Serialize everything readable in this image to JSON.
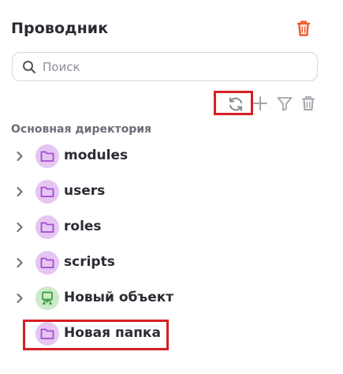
{
  "header": {
    "title": "Проводник",
    "delete_icon": "trash-icon",
    "delete_color": "#f05a2b"
  },
  "search": {
    "placeholder": "Поиск",
    "value": "",
    "icon": "search-icon"
  },
  "toolbar": {
    "icons": [
      "refresh-icon",
      "plus-icon",
      "filter-icon",
      "trash-icon"
    ],
    "icon_color": "#9a9aa3"
  },
  "tree": {
    "section_label": "Основная директория",
    "items": [
      {
        "label": "modules",
        "icon": "folder-icon",
        "expandable": true
      },
      {
        "label": "users",
        "icon": "folder-icon",
        "expandable": true
      },
      {
        "label": "roles",
        "icon": "folder-icon",
        "expandable": true
      },
      {
        "label": "scripts",
        "icon": "folder-icon",
        "expandable": true
      },
      {
        "label": "Новый объект",
        "icon": "object-icon",
        "expandable": true
      },
      {
        "label": "Новая папка",
        "icon": "folder-icon",
        "expandable": false
      }
    ],
    "folder_badge_color": "#e5c6f3",
    "folder_icon_color": "#a24bd0",
    "object_badge_color": "#cdeacb",
    "object_icon_color": "#3c9a3a"
  },
  "highlight_color": "#d71f24"
}
